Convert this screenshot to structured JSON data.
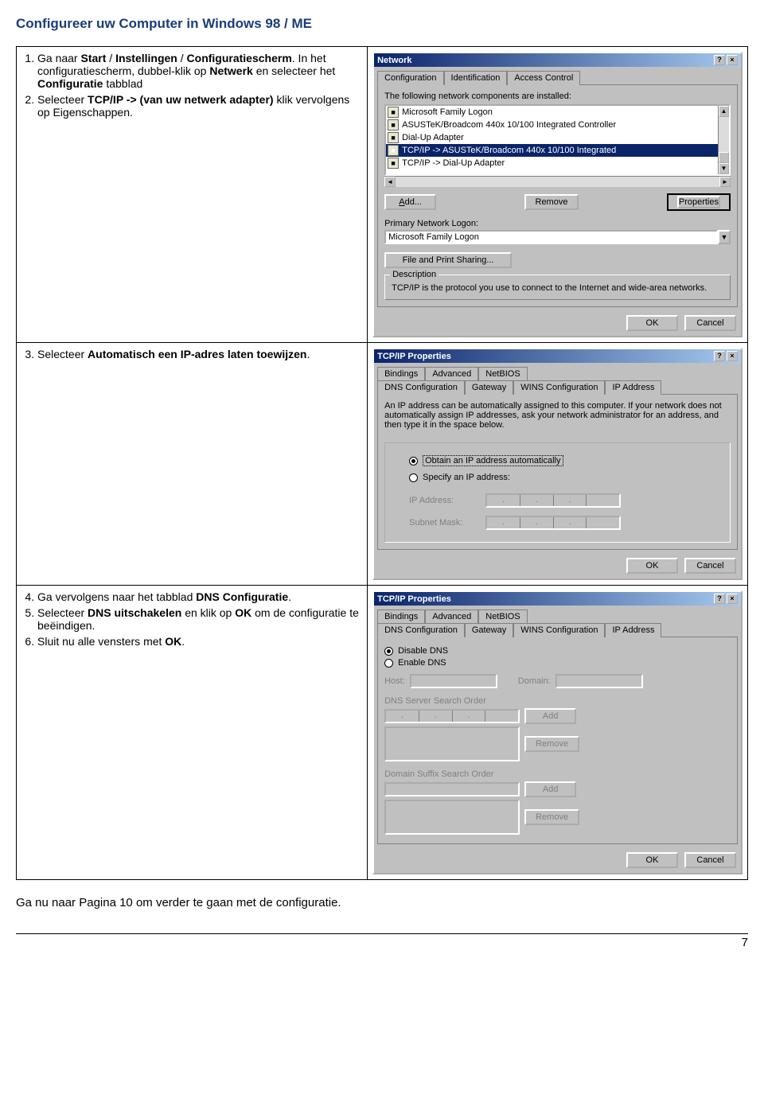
{
  "page_title": "Configureer uw Computer in Windows 98 / ME",
  "page_number": "7",
  "after_table_text": "Ga nu naar Pagina 10 om verder te gaan met de configuratie.",
  "steps_a": {
    "s1_pre": "Ga naar ",
    "s1_b1": "Start",
    "s1_sep1": " / ",
    "s1_b2": "Instellingen",
    "s1_sep2": " / ",
    "s1_b3": "Configuratiescherm",
    "s1_post": ". In het configuratiescherm, dubbel-klik op ",
    "s1_b4": "Netwerk",
    "s1_post2": " en selecteer het ",
    "s1_b5": "Configuratie",
    "s1_post3": " tabblad",
    "s2_pre": "Selecteer ",
    "s2_b1": "TCP/IP -> (van uw netwerk adapter)",
    "s2_post": " klik vervolgens op Eigenschappen."
  },
  "steps_b": {
    "s3_pre": "Selecteer ",
    "s3_b1": "Automatisch een IP-adres laten toewijzen",
    "s3_post": "."
  },
  "steps_c": {
    "s4_pre": "Ga vervolgens naar het tabblad ",
    "s4_b1": "DNS Configuratie",
    "s4_post": ".",
    "s5_pre": "Selecteer ",
    "s5_b1": "DNS uitschakelen",
    "s5_mid": " en klik op ",
    "s5_b2": "OK",
    "s5_post": " om de configuratie te beëindigen.",
    "s6_pre": "Sluit nu alle vensters met ",
    "s6_b1": "OK",
    "s6_post": "."
  },
  "dlg1": {
    "title": "Network",
    "tabs": {
      "t1": "Configuration",
      "t2": "Identification",
      "t3": "Access Control"
    },
    "list_header": "The following network components are installed:",
    "items": {
      "i1": "Microsoft Family Logon",
      "i2": "ASUSTeK/Broadcom 440x 10/100 Integrated Controller",
      "i3": "Dial-Up Adapter",
      "i4": "TCP/IP -> ASUSTeK/Broadcom 440x 10/100 Integrated",
      "i5": "TCP/IP -> Dial-Up Adapter"
    },
    "btn_add": "Add...",
    "btn_remove": "Remove",
    "btn_props": "Properties",
    "logon_label": "Primary Network Logon:",
    "logon_value": "Microsoft Family Logon",
    "btn_share": "File and Print Sharing...",
    "desc_legend": "Description",
    "desc_text": "TCP/IP is the protocol you use to connect to the Internet and wide-area networks.",
    "ok": "OK",
    "cancel": "Cancel"
  },
  "dlg2": {
    "title": "TCP/IP Properties",
    "tabs_top": {
      "t1": "Bindings",
      "t2": "Advanced",
      "t3": "NetBIOS"
    },
    "tabs_bot": {
      "t4": "DNS Configuration",
      "t5": "Gateway",
      "t6": "WINS Configuration",
      "t7": "IP Address"
    },
    "blurb": "An IP address can be automatically assigned to this computer. If your network does not automatically assign IP addresses, ask your network administrator for an address, and then type it in the space below.",
    "opt_auto": "Obtain an IP address automatically",
    "opt_spec": "Specify an IP address:",
    "ip_label": "IP Address:",
    "mask_label": "Subnet Mask:",
    "ok": "OK",
    "cancel": "Cancel"
  },
  "dlg3": {
    "title": "TCP/IP Properties",
    "tabs_top": {
      "t1": "Bindings",
      "t2": "Advanced",
      "t3": "NetBIOS"
    },
    "tabs_bot": {
      "t4": "DNS Configuration",
      "t5": "Gateway",
      "t6": "WINS Configuration",
      "t7": "IP Address"
    },
    "opt_disable": "Disable DNS",
    "opt_enable": "Enable DNS",
    "host_label": "Host:",
    "domain_label": "Domain:",
    "dns_order": "DNS Server Search Order",
    "domain_order": "Domain Suffix Search Order",
    "btn_add": "Add",
    "btn_remove": "Remove",
    "ok": "OK",
    "cancel": "Cancel"
  }
}
